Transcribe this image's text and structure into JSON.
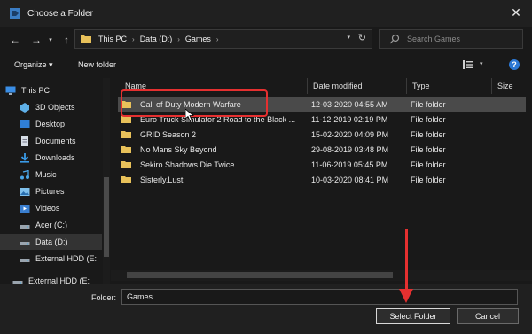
{
  "window": {
    "title": "Choose a Folder",
    "close_glyph": "✕"
  },
  "nav": {
    "back": "←",
    "forward": "→",
    "dropdown": "▾",
    "up": "↑"
  },
  "address": {
    "crumbs": [
      "This PC",
      "Data (D:)",
      "Games"
    ],
    "separator": "›",
    "dropdown": "▾",
    "refresh": "↻"
  },
  "search": {
    "placeholder": "Search Games"
  },
  "toolbar": {
    "organize": "Organize ▾",
    "new_folder": "New folder",
    "view_dropdown": "▾",
    "help": "?"
  },
  "sidebar": {
    "items": [
      {
        "label": "This PC",
        "icon": "pc-icon"
      },
      {
        "label": "3D Objects",
        "icon": "cube-icon"
      },
      {
        "label": "Desktop",
        "icon": "desktop-icon"
      },
      {
        "label": "Documents",
        "icon": "documents-icon"
      },
      {
        "label": "Downloads",
        "icon": "downloads-icon"
      },
      {
        "label": "Music",
        "icon": "music-icon"
      },
      {
        "label": "Pictures",
        "icon": "pictures-icon"
      },
      {
        "label": "Videos",
        "icon": "videos-icon"
      },
      {
        "label": "Acer (C:)",
        "icon": "drive-icon"
      },
      {
        "label": "Data (D:)",
        "icon": "drive-icon"
      },
      {
        "label": "External HDD (E:",
        "icon": "drive-icon"
      },
      {
        "label": "External HDD (E:",
        "icon": "drive-icon"
      }
    ]
  },
  "columns": [
    "Name",
    "Date modified",
    "Type",
    "Size"
  ],
  "files": [
    {
      "name": "Call of Duty Modern Warfare",
      "date": "12-03-2020 04:55 AM",
      "type": "File folder"
    },
    {
      "name": "Euro Truck Simulator 2 Road to the Black ...",
      "date": "11-12-2019 02:19 PM",
      "type": "File folder"
    },
    {
      "name": "GRID Season 2",
      "date": "15-02-2020 04:09 PM",
      "type": "File folder"
    },
    {
      "name": "No Mans Sky Beyond",
      "date": "29-08-2019 03:48 PM",
      "type": "File folder"
    },
    {
      "name": "Sekiro Shadows Die Twice",
      "date": "11-06-2019 05:45 PM",
      "type": "File folder"
    },
    {
      "name": "Sisterly.Lust",
      "date": "10-03-2020 08:41 PM",
      "type": "File folder"
    }
  ],
  "footer": {
    "folder_label": "Folder:",
    "folder_value": "Games",
    "select_button": "Select Folder",
    "cancel_button": "Cancel"
  },
  "colors": {
    "accent": "#2b78d4",
    "annotation": "#e53030",
    "folder": "#e8c15a"
  }
}
